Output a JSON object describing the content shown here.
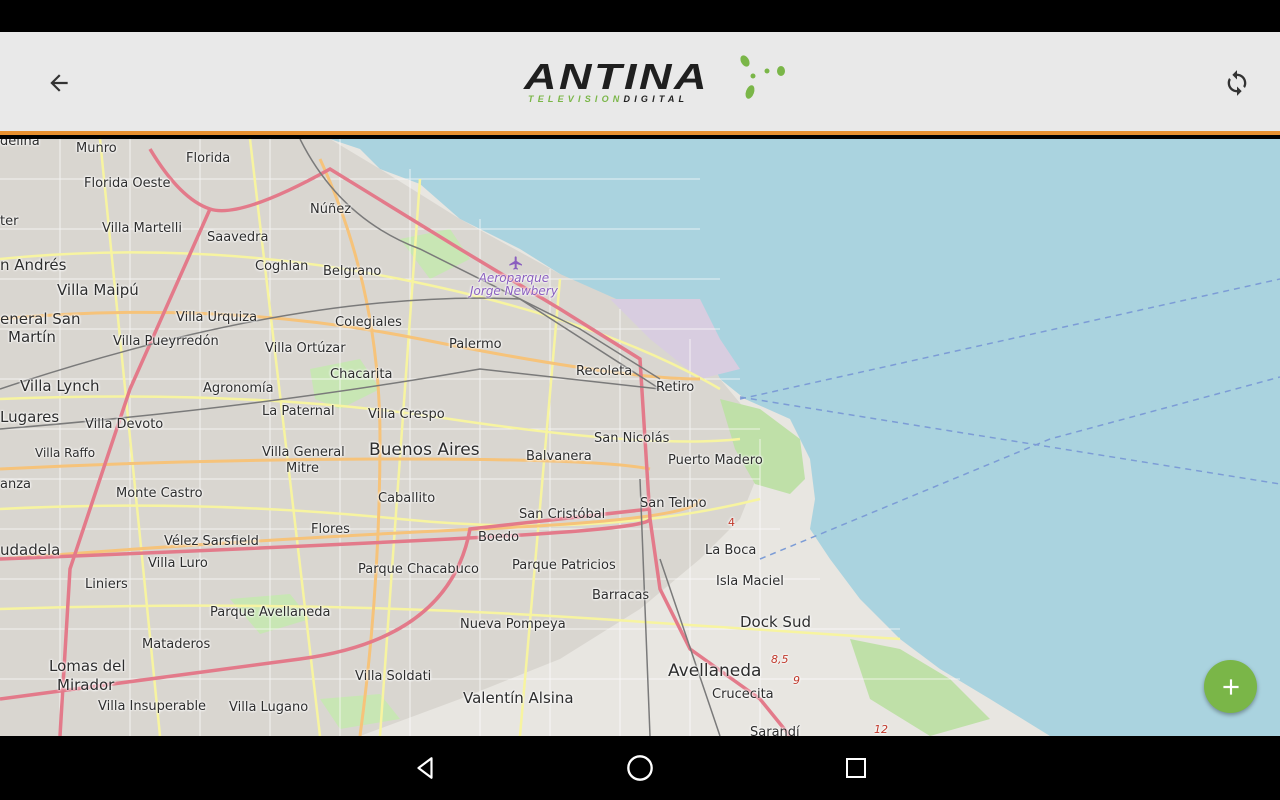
{
  "app": {
    "logo_main": "ANTINA",
    "logo_sub_green": "TELEVISION",
    "logo_sub_dark": "DIGITAL",
    "back_icon": "arrow-left-icon",
    "sync_icon": "sync-icon",
    "accent_color": "#e8902f",
    "brand_green": "#7ab648"
  },
  "map": {
    "water_color": "#aad3df",
    "airport_name_line1": "Aeroparque",
    "airport_name_line2": "Jorge Newbery",
    "labels": [
      {
        "text": "delina"
      },
      {
        "text": "Munro"
      },
      {
        "text": "Florida"
      },
      {
        "text": "Florida Oeste"
      },
      {
        "text": "ter"
      },
      {
        "text": "Villa Martelli"
      },
      {
        "text": "Núñez"
      },
      {
        "text": "Saavedra"
      },
      {
        "text": "n Andrés"
      },
      {
        "text": "Coghlan"
      },
      {
        "text": "Belgrano"
      },
      {
        "text": "Villa Maipú"
      },
      {
        "text": "eneral San"
      },
      {
        "text": "Martín"
      },
      {
        "text": "Villa Urquiza"
      },
      {
        "text": "Colegiales"
      },
      {
        "text": "Villa Pueyrredón"
      },
      {
        "text": "Villa Ortúzar"
      },
      {
        "text": "Palermo"
      },
      {
        "text": "Chacarita"
      },
      {
        "text": "Villa Lynch"
      },
      {
        "text": "Agronomía"
      },
      {
        "text": "Recoleta"
      },
      {
        "text": "Retiro"
      },
      {
        "text": "Lugares"
      },
      {
        "text": "La Paternal"
      },
      {
        "text": "Villa Crespo"
      },
      {
        "text": "Villa Devoto"
      },
      {
        "text": "San Nicolás"
      },
      {
        "text": "Villa Raffo"
      },
      {
        "text": "Villa General"
      },
      {
        "text": "Mitre"
      },
      {
        "text": "Buenos Aires"
      },
      {
        "text": "Balvanera"
      },
      {
        "text": "Puerto Madero"
      },
      {
        "text": "anza"
      },
      {
        "text": "Monte Castro"
      },
      {
        "text": "Caballito"
      },
      {
        "text": "San Telmo"
      },
      {
        "text": "Flores"
      },
      {
        "text": "San Cristóbal"
      },
      {
        "text": "udadela"
      },
      {
        "text": "Vélez Sarsfield"
      },
      {
        "text": "Boedo"
      },
      {
        "text": "La Boca"
      },
      {
        "text": "Villa Luro"
      },
      {
        "text": "Parque Chacabuco"
      },
      {
        "text": "Parque Patricios"
      },
      {
        "text": "Liniers"
      },
      {
        "text": "Isla Maciel"
      },
      {
        "text": "Barracas"
      },
      {
        "text": "Parque Avellaneda"
      },
      {
        "text": "Nueva Pompeya"
      },
      {
        "text": "Dock Sud"
      },
      {
        "text": "Mataderos"
      },
      {
        "text": "Lomas del"
      },
      {
        "text": "Mirador"
      },
      {
        "text": "Avellaneda"
      },
      {
        "text": "Villa Soldati"
      },
      {
        "text": "Crucecita"
      },
      {
        "text": "Valentín Alsina"
      },
      {
        "text": "Villa Insuperable"
      },
      {
        "text": "Villa Lugano"
      },
      {
        "text": "Sarandí"
      },
      {
        "text": "4"
      },
      {
        "text": "8,5"
      },
      {
        "text": "9"
      },
      {
        "text": "12"
      }
    ]
  },
  "fab": {
    "icon": "plus-icon"
  },
  "navbar": {
    "back_icon": "nav-back-icon",
    "home_icon": "nav-home-icon",
    "recents_icon": "nav-recents-icon"
  }
}
